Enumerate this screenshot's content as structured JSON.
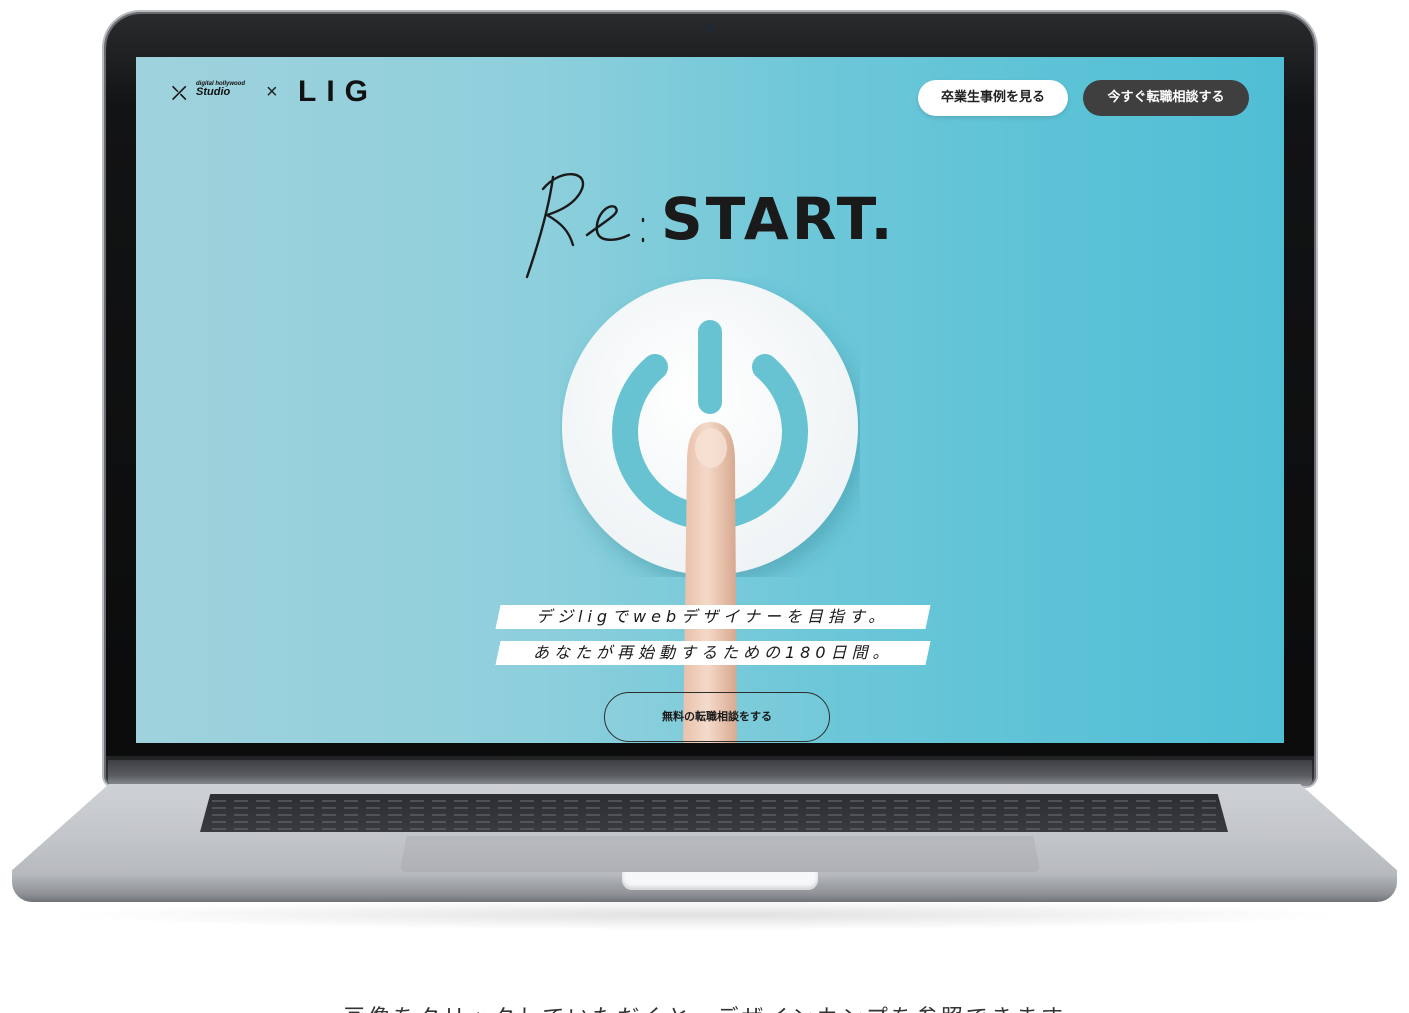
{
  "header": {
    "logo_brand_small": "digital hollywood",
    "logo_brand_big": "Studio",
    "logo_separator": "×",
    "logo_partner": "LIG",
    "cases_button": "卒業生事例を見る",
    "consult_button": "今すぐ転職相談する"
  },
  "hero": {
    "title_script": "Re:",
    "title_main": "START.",
    "tagline_1": "デジligでwebデザイナーを目指す。",
    "tagline_2": "あなたが再始動するための180日間。",
    "cta": "無料の転職相談をする"
  },
  "caption": "画像をクリックしていただくと、デザインカンプを参照できます",
  "colors": {
    "screen_bg_left": "#9fd2dc",
    "screen_bg_right": "#4fbed5",
    "power_icon": "#67c3d1",
    "dark_button": "#3f3f3f"
  },
  "icons": [
    "power-icon",
    "finger-image"
  ]
}
